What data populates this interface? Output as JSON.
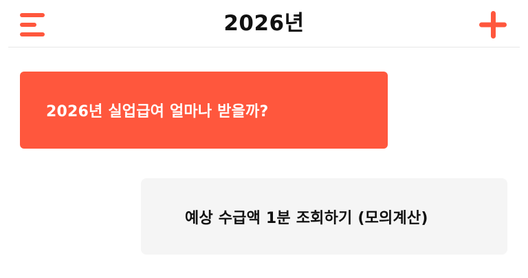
{
  "header": {
    "title": "2026년",
    "menu_icon": "hamburger-menu-icon",
    "add_icon": "plus-icon",
    "accent_color": "#ff573d"
  },
  "chat": {
    "messages": [
      {
        "role": "prompt",
        "text": "2026년 실업급여 얼마나 받을까?",
        "color": "#ff573d"
      },
      {
        "role": "reply",
        "text": "예상 수급액 1분 조회하기 (모의계산)",
        "color": "#f5f5f5"
      }
    ]
  }
}
